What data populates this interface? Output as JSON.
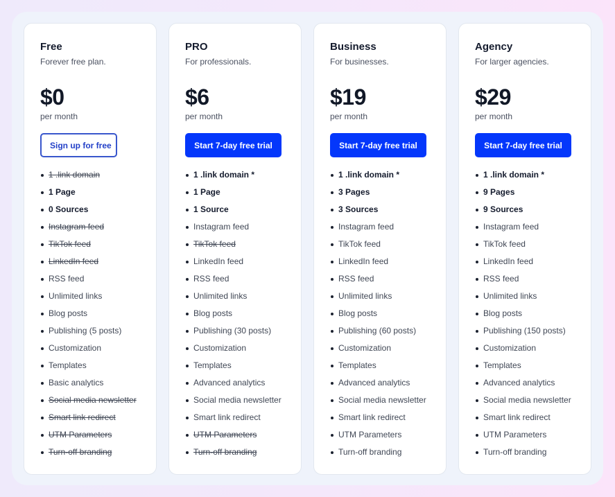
{
  "colors": {
    "primary_button": "#0437fb",
    "outline_button_text": "#2340c8",
    "heading_text": "#141b2d",
    "body_text": "#3f4654"
  },
  "plans": [
    {
      "name": "Free",
      "description": "Forever free plan.",
      "price": "$0",
      "period": "per month",
      "button": {
        "label": "Sign up for free",
        "style": "outline"
      },
      "features": [
        {
          "label": "1 .link domain",
          "included": false,
          "bold": false
        },
        {
          "label": "1 Page",
          "included": true,
          "bold": true
        },
        {
          "label": "0 Sources",
          "included": true,
          "bold": true
        },
        {
          "label": "Instagram feed",
          "included": false,
          "bold": false
        },
        {
          "label": "TikTok feed",
          "included": false,
          "bold": false
        },
        {
          "label": "LinkedIn feed",
          "included": false,
          "bold": false
        },
        {
          "label": "RSS feed",
          "included": true,
          "bold": false
        },
        {
          "label": "Unlimited links",
          "included": true,
          "bold": false
        },
        {
          "label": "Blog posts",
          "included": true,
          "bold": false
        },
        {
          "label": "Publishing (5 posts)",
          "included": true,
          "bold": false
        },
        {
          "label": "Customization",
          "included": true,
          "bold": false
        },
        {
          "label": "Templates",
          "included": true,
          "bold": false
        },
        {
          "label": "Basic analytics",
          "included": true,
          "bold": false
        },
        {
          "label": "Social media newsletter",
          "included": false,
          "bold": false
        },
        {
          "label": "Smart link redirect",
          "included": false,
          "bold": false
        },
        {
          "label": "UTM Parameters",
          "included": false,
          "bold": false
        },
        {
          "label": "Turn-off branding",
          "included": false,
          "bold": false
        }
      ]
    },
    {
      "name": "PRO",
      "description": "For professionals.",
      "price": "$6",
      "period": "per month",
      "button": {
        "label": "Start 7-day free trial",
        "style": "primary"
      },
      "features": [
        {
          "label": "1 .link domain *",
          "included": true,
          "bold": true
        },
        {
          "label": "1 Page",
          "included": true,
          "bold": true
        },
        {
          "label": "1 Source",
          "included": true,
          "bold": true
        },
        {
          "label": "Instagram feed",
          "included": true,
          "bold": false
        },
        {
          "label": "TikTok feed",
          "included": false,
          "bold": false
        },
        {
          "label": "LinkedIn feed",
          "included": true,
          "bold": false
        },
        {
          "label": "RSS feed",
          "included": true,
          "bold": false
        },
        {
          "label": "Unlimited links",
          "included": true,
          "bold": false
        },
        {
          "label": "Blog posts",
          "included": true,
          "bold": false
        },
        {
          "label": "Publishing (30 posts)",
          "included": true,
          "bold": false
        },
        {
          "label": "Customization",
          "included": true,
          "bold": false
        },
        {
          "label": "Templates",
          "included": true,
          "bold": false
        },
        {
          "label": "Advanced analytics",
          "included": true,
          "bold": false
        },
        {
          "label": "Social media newsletter",
          "included": true,
          "bold": false
        },
        {
          "label": "Smart link redirect",
          "included": true,
          "bold": false
        },
        {
          "label": "UTM Parameters",
          "included": false,
          "bold": false
        },
        {
          "label": "Turn-off branding",
          "included": false,
          "bold": false
        }
      ]
    },
    {
      "name": "Business",
      "description": "For businesses.",
      "price": "$19",
      "period": "per month",
      "button": {
        "label": "Start 7-day free trial",
        "style": "primary"
      },
      "features": [
        {
          "label": "1 .link domain *",
          "included": true,
          "bold": true
        },
        {
          "label": "3 Pages",
          "included": true,
          "bold": true
        },
        {
          "label": "3 Sources",
          "included": true,
          "bold": true
        },
        {
          "label": "Instagram feed",
          "included": true,
          "bold": false
        },
        {
          "label": "TikTok feed",
          "included": true,
          "bold": false
        },
        {
          "label": "LinkedIn feed",
          "included": true,
          "bold": false
        },
        {
          "label": "RSS feed",
          "included": true,
          "bold": false
        },
        {
          "label": "Unlimited links",
          "included": true,
          "bold": false
        },
        {
          "label": "Blog posts",
          "included": true,
          "bold": false
        },
        {
          "label": "Publishing (60 posts)",
          "included": true,
          "bold": false
        },
        {
          "label": "Customization",
          "included": true,
          "bold": false
        },
        {
          "label": "Templates",
          "included": true,
          "bold": false
        },
        {
          "label": "Advanced analytics",
          "included": true,
          "bold": false
        },
        {
          "label": "Social media newsletter",
          "included": true,
          "bold": false
        },
        {
          "label": "Smart link redirect",
          "included": true,
          "bold": false
        },
        {
          "label": "UTM Parameters",
          "included": true,
          "bold": false
        },
        {
          "label": "Turn-off branding",
          "included": true,
          "bold": false
        }
      ]
    },
    {
      "name": "Agency",
      "description": "For larger agencies.",
      "price": "$29",
      "period": "per month",
      "button": {
        "label": "Start 7-day free trial",
        "style": "primary"
      },
      "features": [
        {
          "label": "1 .link domain *",
          "included": true,
          "bold": true
        },
        {
          "label": "9 Pages",
          "included": true,
          "bold": true
        },
        {
          "label": "9 Sources",
          "included": true,
          "bold": true
        },
        {
          "label": "Instagram feed",
          "included": true,
          "bold": false
        },
        {
          "label": "TikTok feed",
          "included": true,
          "bold": false
        },
        {
          "label": "LinkedIn feed",
          "included": true,
          "bold": false
        },
        {
          "label": "RSS feed",
          "included": true,
          "bold": false
        },
        {
          "label": "Unlimited links",
          "included": true,
          "bold": false
        },
        {
          "label": "Blog posts",
          "included": true,
          "bold": false
        },
        {
          "label": "Publishing (150 posts)",
          "included": true,
          "bold": false
        },
        {
          "label": "Customization",
          "included": true,
          "bold": false
        },
        {
          "label": "Templates",
          "included": true,
          "bold": false
        },
        {
          "label": "Advanced analytics",
          "included": true,
          "bold": false
        },
        {
          "label": "Social media newsletter",
          "included": true,
          "bold": false
        },
        {
          "label": "Smart link redirect",
          "included": true,
          "bold": false
        },
        {
          "label": "UTM Parameters",
          "included": true,
          "bold": false
        },
        {
          "label": "Turn-off branding",
          "included": true,
          "bold": false
        }
      ]
    }
  ]
}
